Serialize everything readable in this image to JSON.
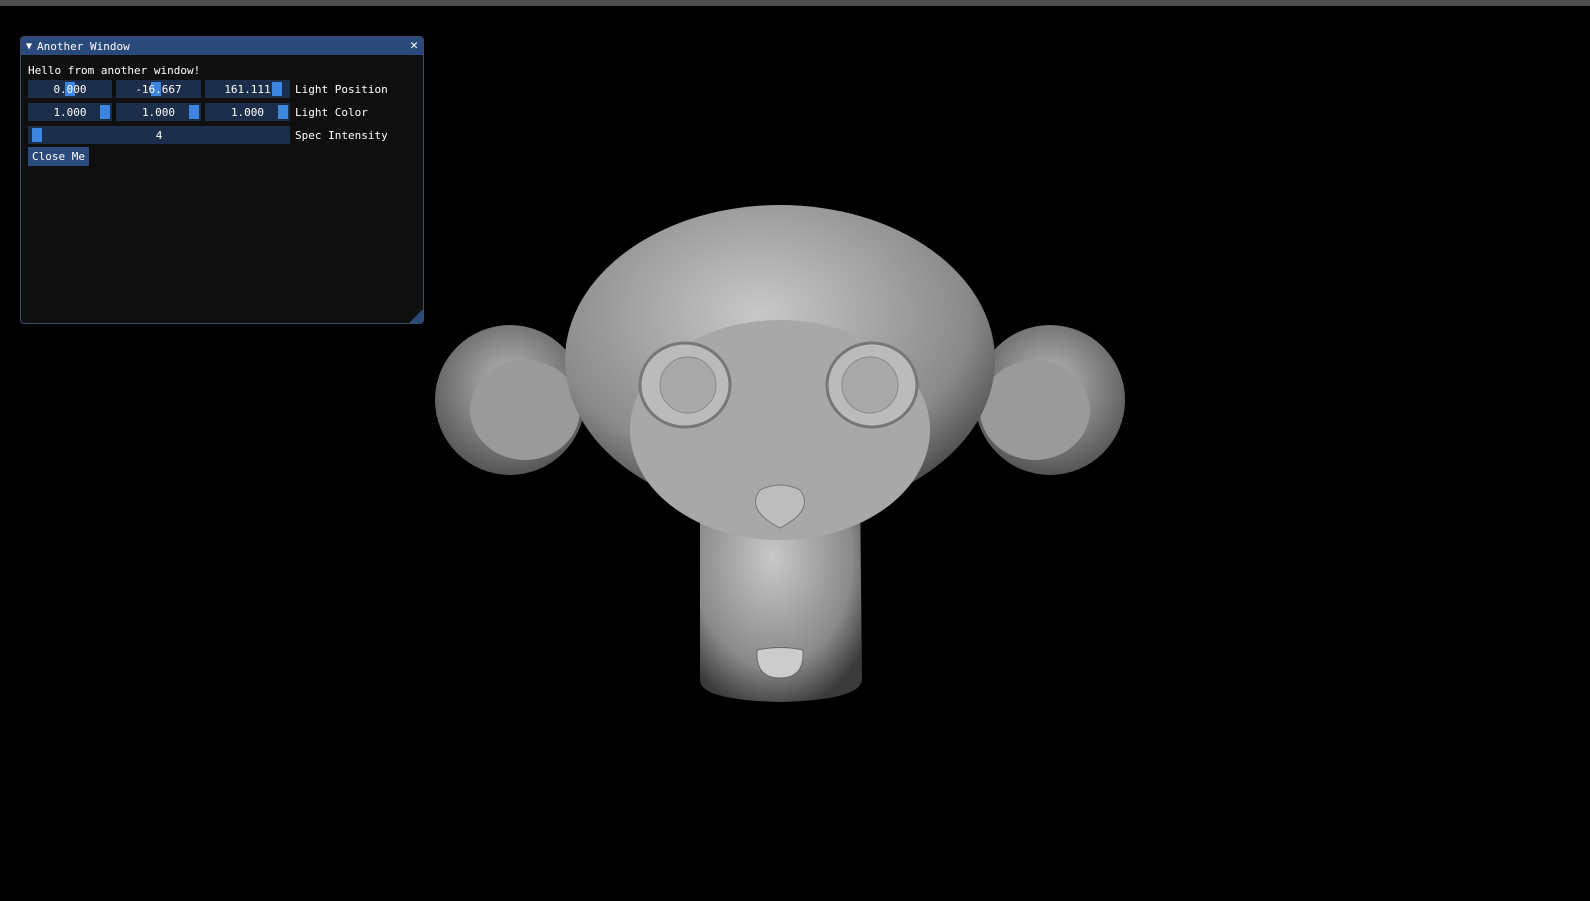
{
  "window": {
    "title": "Another Window",
    "text": "Hello from another window!",
    "light_position": {
      "label": "Light Position",
      "values": [
        "0.000",
        "-16.667",
        "161.111"
      ],
      "slider_fraction": [
        0.5,
        0.46,
        1.0
      ]
    },
    "light_color": {
      "label": "Light Color",
      "values": [
        "1.000",
        "1.000",
        "1.000"
      ],
      "slider_fraction": [
        1.0,
        1.0,
        1.0
      ]
    },
    "spec_intensity": {
      "label": "Spec Intensity",
      "value": "4",
      "slider_fraction": 0.0
    },
    "close_button": "Close Me"
  },
  "colors": {
    "accent": "#3d85e0",
    "title_bar": "#294a7a",
    "frame_bg": "#1d2e4a"
  }
}
